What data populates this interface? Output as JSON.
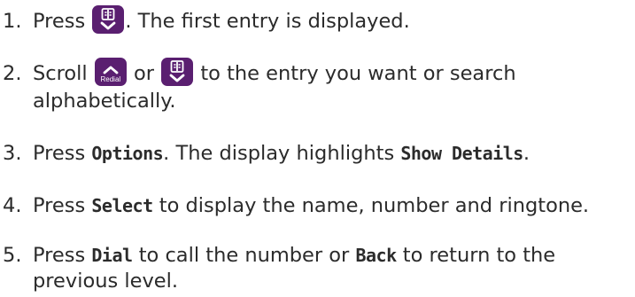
{
  "colors": {
    "heading": "#1f5fa6",
    "key_background": "#5a1f70",
    "key_glyph": "#ffffff",
    "body_text": "#2b2b2b"
  },
  "heading_fragment": "",
  "steps": [
    {
      "number": "1.",
      "before_key": "Press ",
      "key_icon": "phonebook-down-key",
      "after_key": ". The first entry is displayed."
    },
    {
      "number": "2.",
      "before_first_key": "Scroll ",
      "first_key_icon": "redial-up-key",
      "first_key_label": "Redial",
      "between_keys": " or ",
      "second_key_icon": "phonebook-down-key",
      "after_keys": " to the entry you want or search",
      "continuation": "alphabetically."
    },
    {
      "number": "3.",
      "before": "Press ",
      "display_text_1": "Options",
      "middle": ". The display highlights ",
      "display_text_2": "Show Details",
      "after": "."
    },
    {
      "number": "4.",
      "before": "Press ",
      "display_text": "Select",
      "after": " to display the name, number and ringtone."
    },
    {
      "number": "5.",
      "before": "Press ",
      "display_text_1": "Dial",
      "middle": " to call the number or ",
      "display_text_2": "Back",
      "after": " to return to the",
      "continuation": "previous level."
    }
  ]
}
